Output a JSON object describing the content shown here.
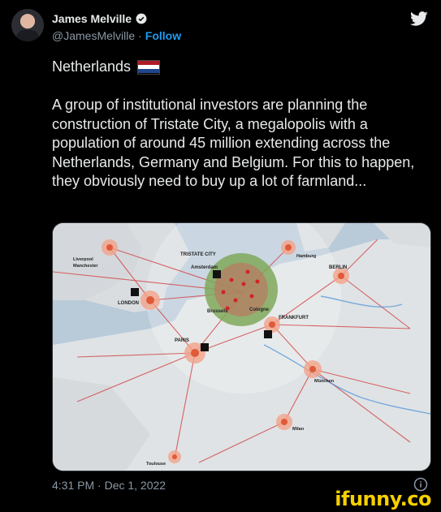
{
  "author": {
    "name": "James Melville",
    "handle": "@JamesMelville",
    "separator": "·",
    "follow_label": "Follow"
  },
  "tweet": {
    "country": "Netherlands",
    "body": "A group of institutional investors are planning the construction of Tristate City, a megalopolis with a population of around 45 million extending across the Netherlands, Germany and Belgium. For this to happen, they obviously need to buy up a lot of farmland...",
    "timestamp": "4:31 PM · Dec 1, 2022"
  },
  "map": {
    "labels": {
      "tristate": "TRISTATE CITY",
      "amsterdam": "Amsterdam",
      "hamburg": "Hamburg",
      "berlin": "BERLIN",
      "liverpool": "Liverpool",
      "manchester": "Manchester",
      "london": "LONDON",
      "brussels": "Brussels",
      "cologne": "Cologne",
      "frankfurt": "FRANKFURT",
      "paris": "PARIS",
      "munchen": "München",
      "milan": "Milan",
      "toulouse": "Toulouse"
    }
  },
  "watermark": "ifunny.co",
  "colors": {
    "accent": "#1d9bf0",
    "flag_red": "#ae1c28",
    "flag_white": "#ffffff",
    "flag_blue": "#21468b",
    "watermark": "#f6d000"
  }
}
